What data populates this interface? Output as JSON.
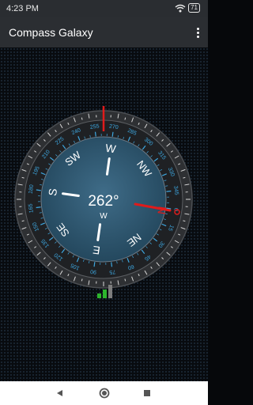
{
  "status_bar": {
    "time": "4:23 PM",
    "battery": "71"
  },
  "app_bar": {
    "title": "Compass Galaxy",
    "menu_icon": "more-vert-icon"
  },
  "compass": {
    "heading_degrees": "262°",
    "heading_direction": "W",
    "cardinals": [
      "N",
      "NE",
      "E",
      "SE",
      "S",
      "SW",
      "W",
      "NW"
    ],
    "ring_numbers": [
      "0",
      "15",
      "30",
      "45",
      "60",
      "75",
      "90",
      "105",
      "120",
      "135",
      "150",
      "165",
      "180",
      "195",
      "210",
      "225",
      "240",
      "255",
      "270",
      "285",
      "300",
      "315",
      "330",
      "345"
    ],
    "needle_color": "#e01b1b",
    "accent_color": "#3da7e0"
  },
  "signal_icon": {
    "name": "signal-strength-icon",
    "active_bars": 2,
    "total_bars": 3
  },
  "nav_bar": {
    "back": "back-icon",
    "home": "home-icon",
    "recents": "recents-icon"
  }
}
